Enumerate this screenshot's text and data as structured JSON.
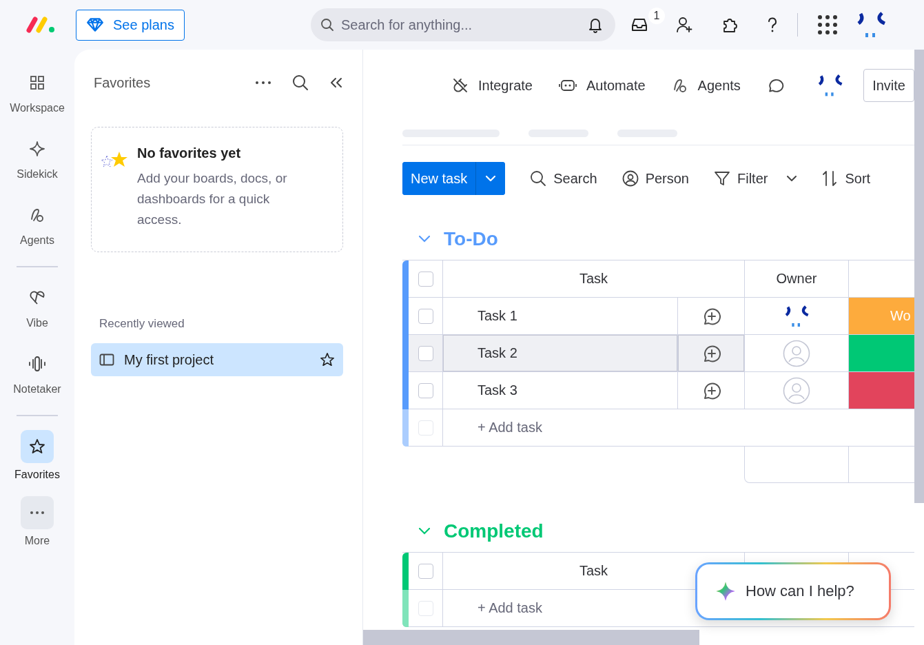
{
  "top_bar": {
    "plans_button": "See plans",
    "search": {
      "placeholder": "Search for anything..."
    },
    "inbox_badge": "1"
  },
  "rail": [
    [
      {
        "label": "Workspace",
        "kind": "grid",
        "selected": false
      },
      {
        "label": "Sidekick",
        "kind": "sparkle",
        "selected": false
      },
      {
        "label": "Agents",
        "kind": "agents",
        "selected": false
      }
    ],
    [
      {
        "label": "Vibe",
        "kind": "heart",
        "selected": false
      },
      {
        "label": "Notetaker",
        "kind": "wave",
        "selected": false
      }
    ],
    [
      {
        "label": "Favorites",
        "kind": "star",
        "selected": true
      },
      {
        "label": "More",
        "kind": "more",
        "selected": false
      }
    ]
  ],
  "favorites": {
    "title": "Favorites",
    "empty_title": "No favorites yet",
    "empty_text": "Add your boards, docs, or dashboards for a quick access.",
    "recent_heading": "Recently viewed",
    "recent": [
      {
        "label": "My first project",
        "selected": true
      }
    ]
  },
  "board_toolbar": [
    {
      "label": "Integrate",
      "kind": "integrate"
    },
    {
      "label": "Automate",
      "kind": "automate"
    },
    {
      "label": "Agents",
      "kind": "agents"
    }
  ],
  "invite_button": "Invite",
  "actions": {
    "new_task": "New task",
    "tools": [
      {
        "label": "Search",
        "kind": "search"
      },
      {
        "label": "Person",
        "kind": "person"
      },
      {
        "label": "Filter",
        "kind": "filter"
      },
      {
        "label": "Sort",
        "kind": "sort"
      }
    ]
  },
  "groups": [
    {
      "title": "To-Do",
      "color": "#579bfc",
      "all_checked": false,
      "add_checked": false,
      "columns": [
        "Task",
        "Owner"
      ],
      "summary": true,
      "add_label": "+ Add task",
      "rows": [
        {
          "task": "Task 1",
          "checked": false,
          "assigned": true,
          "selected": false,
          "status": "Wo",
          "color": "#fdab3d"
        },
        {
          "task": "Task 2",
          "checked": false,
          "assigned": false,
          "selected": true,
          "color": "#00c875"
        },
        {
          "task": "Task 3",
          "checked": false,
          "assigned": false,
          "selected": false,
          "color": "#e2445c"
        }
      ]
    },
    {
      "title": "Completed",
      "color": "#00c875",
      "all_checked": false,
      "add_checked": false,
      "columns": [
        "Task"
      ],
      "summary": false,
      "add_label": "+ Add task"
    }
  ],
  "assistant": {
    "prompt": "How can I help?"
  }
}
